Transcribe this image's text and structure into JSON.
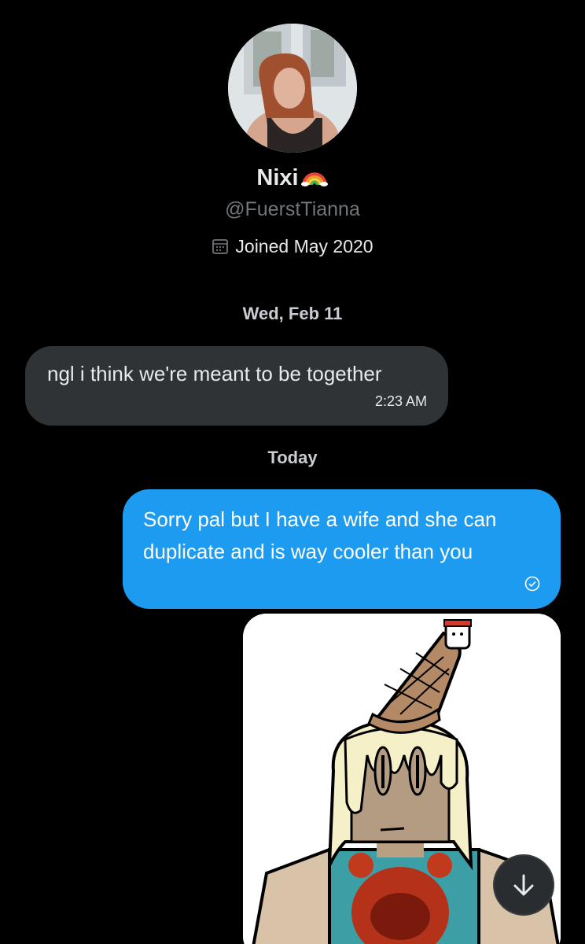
{
  "profile": {
    "display_name": "Nixi",
    "handle": "@FuerstTianna",
    "joined": "Joined May 2020"
  },
  "conversation": {
    "date_separator_1": "Wed, Feb 11",
    "incoming_message": {
      "text": "ngl i think we're meant to be together",
      "time": "2:23 AM"
    },
    "date_separator_2": "Today",
    "outgoing_message": {
      "text": "Sorry pal but I have a wife and she can duplicate and is way cooler than you",
      "status_icon": "check-circle-icon"
    },
    "attachment": {
      "type": "image",
      "description_icon": "drawing-image"
    }
  },
  "controls": {
    "scroll_down_icon": "arrow-down-icon"
  },
  "colors": {
    "background": "#000000",
    "incoming_bubble": "#2f3336",
    "outgoing_bubble": "#1d9bf0",
    "secondary_text": "#71767b"
  }
}
